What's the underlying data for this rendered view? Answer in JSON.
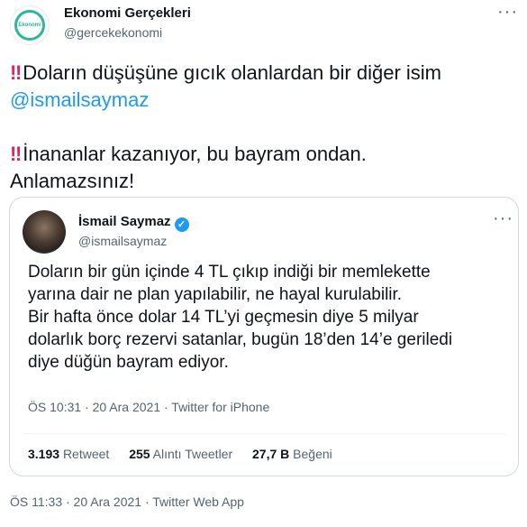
{
  "tweet": {
    "author_name": "Ekonomi Gerçekleri",
    "author_handle": "@gercekekonomi",
    "avatar_text": "Ekonomi",
    "more_label": "···",
    "line1_icon": "‼",
    "line1": "Doların düşüşüne gıcık olanlardan bir diğer isim",
    "mention": "@ismailsaymaz",
    "line2_icon": "‼",
    "line2": "İnananlar kazanıyor, bu bayram ondan.",
    "line3": "Anlamazsınız!",
    "meta": "ÖS 11:33 · 20 Ara 2021 · Twitter Web App"
  },
  "quote": {
    "author_name": "İsmail Saymaz",
    "verified_mark": "✓",
    "author_handle": "@ismailsaymaz",
    "more_label": "···",
    "lines": [
      "Doların bir gün içinde 4 TL çıkıp indiği bir memlekette",
      "yarına dair ne plan yapılabilir, ne hayal kurulabilir.",
      "Bir hafta önce dolar 14 TL’yi geçmesin diye 5 milyar",
      "dolarlık borç rezervi satanlar, bugün 18’den 14’e geriledi",
      "diye düğün bayram ediyor."
    ],
    "meta": "ÖS 10:31 · 20 Ara 2021 · Twitter for iPhone",
    "retweets_count": "3.193",
    "retweets_label": "Retweet",
    "quotes_count": "255",
    "quotes_label": "Alıntı Tweetler",
    "likes_count": "27,7 B",
    "likes_label": "Beğeni"
  }
}
